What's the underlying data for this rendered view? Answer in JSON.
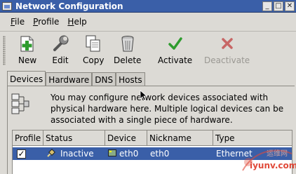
{
  "window": {
    "title": "Network Configuration"
  },
  "menubar": {
    "items": [
      "File",
      "Profile",
      "Help"
    ]
  },
  "toolbar": {
    "buttons": [
      {
        "label": "New",
        "icon": "new-icon",
        "enabled": true
      },
      {
        "label": "Edit",
        "icon": "wrench-icon",
        "enabled": true
      },
      {
        "label": "Copy",
        "icon": "copy-icon",
        "enabled": true
      },
      {
        "label": "Delete",
        "icon": "trash-icon",
        "enabled": true
      },
      {
        "label": "Activate",
        "icon": "checkmark-icon",
        "enabled": true
      },
      {
        "label": "Deactivate",
        "icon": "x-icon",
        "enabled": false
      }
    ]
  },
  "tabs": [
    {
      "label": "Devices",
      "active": true
    },
    {
      "label": "Hardware",
      "active": false
    },
    {
      "label": "DNS",
      "active": false
    },
    {
      "label": "Hosts",
      "active": false
    }
  ],
  "info": {
    "text": "You may configure network devices associated with physical hardware here.  Multiple logical devices can be associated with a single piece of hardware."
  },
  "table": {
    "columns": [
      "Profile",
      "Status",
      "Device",
      "Nickname",
      "Type"
    ],
    "rows": [
      {
        "profile": "✓",
        "status": "Inactive",
        "device": "eth0",
        "nickname": "eth0",
        "type": "Ethernet"
      }
    ]
  },
  "watermark": {
    "text": "iyunv.com",
    "cn": "运维网"
  },
  "colors": {
    "titlebar": "#3a5fa8",
    "selection": "#3a5fa8",
    "window_bg": "#dcdad5",
    "activate_green": "#2e9c2e",
    "deactivate_red": "#c04040"
  }
}
